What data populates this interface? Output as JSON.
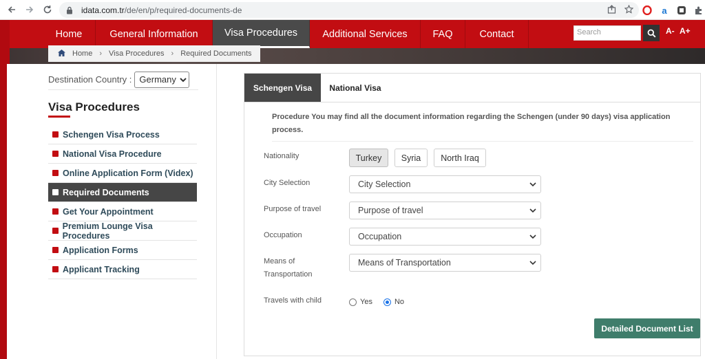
{
  "browser": {
    "url_domain": "idata.com.tr",
    "url_path": "/de/en/p/required-documents-de"
  },
  "nav": {
    "items": [
      {
        "label": "Home"
      },
      {
        "label": "General Information"
      },
      {
        "label": "Visa Procedures",
        "active": true
      },
      {
        "label": "Additional Services"
      },
      {
        "label": "FAQ"
      },
      {
        "label": "Contact"
      }
    ],
    "search_placeholder": "Search",
    "font_decrease": "A-",
    "font_increase": "A+"
  },
  "breadcrumb": {
    "home": "Home",
    "level1": "Visa Procedures",
    "current": "Required Documents"
  },
  "sidebar": {
    "destination_label": "Destination Country :",
    "destination_value": "Germany",
    "title": "Visa Procedures",
    "items": [
      {
        "label": "Schengen Visa Process"
      },
      {
        "label": "National Visa Procedure"
      },
      {
        "label": "Online Application Form (Videx)"
      },
      {
        "label": "Required Documents",
        "active": true
      },
      {
        "label": "Get Your Appointment"
      },
      {
        "label": "Premium Lounge Visa Procedures"
      },
      {
        "label": "Application Forms"
      },
      {
        "label": "Applicant Tracking"
      }
    ]
  },
  "tabs": {
    "schengen": "Schengen Visa",
    "national": "National Visa"
  },
  "form": {
    "intro": "Procedure You may find all the document information regarding the Schengen (under 90 days) visa application process.",
    "nationality_label": "Nationality",
    "nationalities": [
      "Turkey",
      "Syria",
      "North Iraq"
    ],
    "selected_nationality": "Turkey",
    "city_label": "City Selection",
    "city_value": "City Selection",
    "purpose_label": "Purpose of travel",
    "purpose_value": "Purpose of travel",
    "occupation_label": "Occupation",
    "occupation_value": "Occupation",
    "means_label": "Means of Transportation",
    "means_value": "Means of Transportation",
    "child_label": "Travels with child",
    "yes_label": "Yes",
    "no_label": "No",
    "travels_with_child": "No",
    "submit_label": "Detailed Document List"
  },
  "colors": {
    "brand_red": "#c20d12",
    "dark_gray": "#464646",
    "button_green": "#3f7d6b"
  }
}
